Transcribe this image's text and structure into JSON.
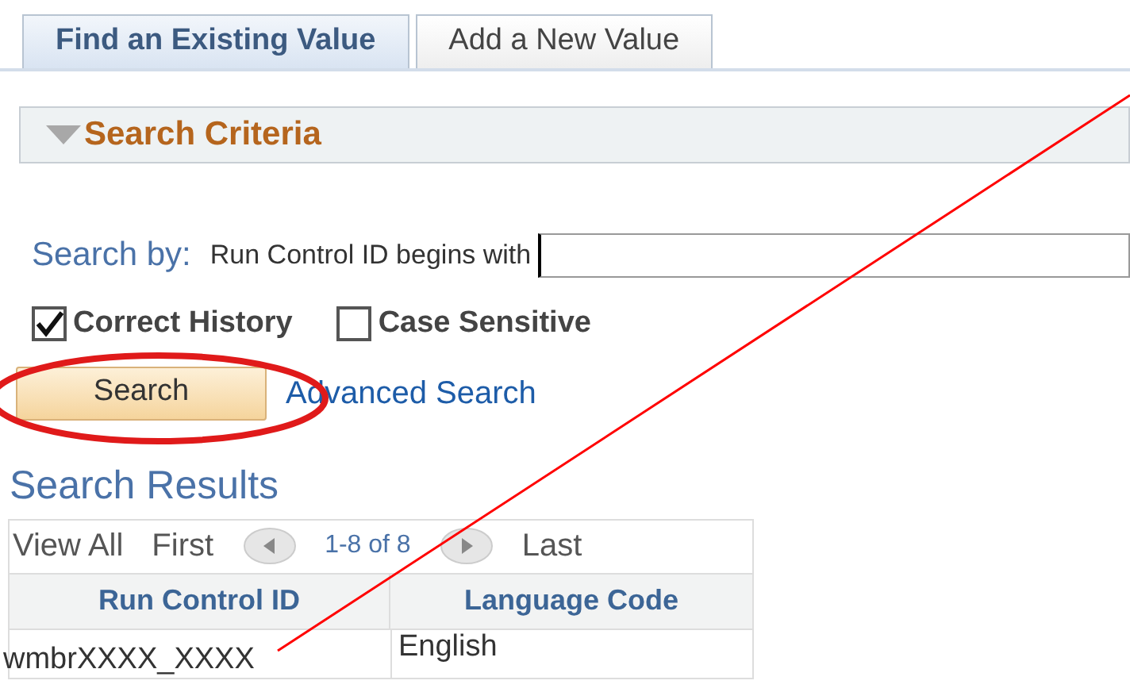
{
  "tabs": [
    {
      "label": "Find an Existing Value",
      "selected": true
    },
    {
      "label": "Add a New Value",
      "selected": false
    }
  ],
  "search_criteria": {
    "title": "Search Criteria",
    "expanded": true,
    "search_by": "Search by:",
    "field_label": "Run Control ID begins with",
    "checkboxes": [
      {
        "label": "Correct History",
        "checked": true
      },
      {
        "label": "Case Sensitive",
        "checked": false
      }
    ],
    "search_button": "Search",
    "advanced_link": "Advanced Search"
  },
  "results": {
    "title": "Search Results",
    "nav": [
      {
        "kind": "link",
        "label": "View All"
      },
      {
        "kind": "link",
        "label": "First"
      },
      {
        "kind": "prev"
      },
      {
        "kind": "count",
        "label": "1-8 of 8"
      },
      {
        "kind": "next"
      },
      {
        "kind": "link",
        "label": "Last"
      }
    ],
    "columns": [
      "Run Control ID",
      "Language Code"
    ],
    "rows": [
      [
        "wmbrXXXX_XXXX",
        "English"
      ]
    ]
  }
}
